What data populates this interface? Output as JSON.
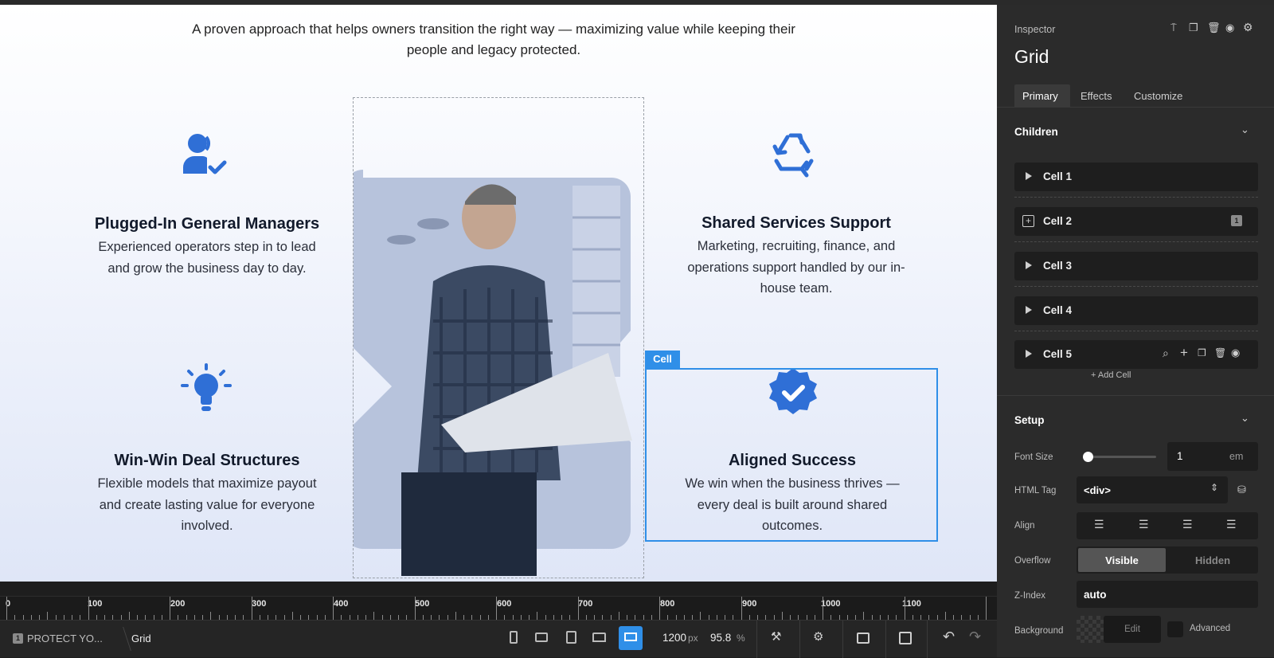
{
  "canvas": {
    "intro": "A proven approach that helps owners transition the right way — maximizing value while keeping their people and legacy protected.",
    "features": [
      {
        "title": "Plugged-In General Managers",
        "text": "Experienced operators step in to lead and grow the business day to day.",
        "icon": "user-check-icon"
      },
      {
        "title": "Shared Services Support",
        "text": "Marketing, recruiting, finance, and operations support handled by our in-house team.",
        "icon": "recycle-icon"
      },
      {
        "title": "Win-Win Deal Structures",
        "text": "Flexible models that maximize payout and create lasting value for everyone involved.",
        "icon": "lightbulb-icon"
      },
      {
        "title": "Aligned Success",
        "text": "We win when the business thrives — every deal is built around shared outcomes.",
        "icon": "verified-badge-icon"
      }
    ],
    "cell_tag": "Cell",
    "accent": "#2f6fd6",
    "selection_color": "#2f8fe8"
  },
  "ruler": {
    "ticks": [
      "0",
      "100",
      "200",
      "300",
      "400",
      "500",
      "600",
      "700",
      "800",
      "900",
      "1000",
      "1100"
    ]
  },
  "bottombar": {
    "page_badge": "1",
    "page_name": "PROTECT YO...",
    "breadcrumb": "Grid",
    "width_value": "1200",
    "width_unit": "px",
    "zoom_value": "95.8",
    "zoom_unit": "%"
  },
  "inspector": {
    "label": "Inspector",
    "title": "Grid",
    "tabs": [
      "Primary",
      "Effects",
      "Customize"
    ],
    "active_tab": "Primary",
    "children_label": "Children",
    "cells": [
      {
        "label": "Cell 1"
      },
      {
        "label": "Cell 2",
        "badge": "1"
      },
      {
        "label": "Cell 3"
      },
      {
        "label": "Cell 4"
      },
      {
        "label": "Cell 5"
      }
    ],
    "add_cell": "Add Cell",
    "setup_label": "Setup",
    "font_size_label": "Font Size",
    "font_size_value": "1",
    "font_size_unit": "em",
    "font_size_slider": 0.1,
    "html_tag_label": "HTML Tag",
    "html_tag_value": "<div>",
    "align_label": "Align",
    "overflow_label": "Overflow",
    "overflow_options": [
      "Visible",
      "Hidden"
    ],
    "overflow_selected": "Visible",
    "zindex_label": "Z-Index",
    "zindex_value": "auto",
    "background_label": "Background",
    "background_edit": "Edit",
    "advanced_label": "Advanced"
  }
}
